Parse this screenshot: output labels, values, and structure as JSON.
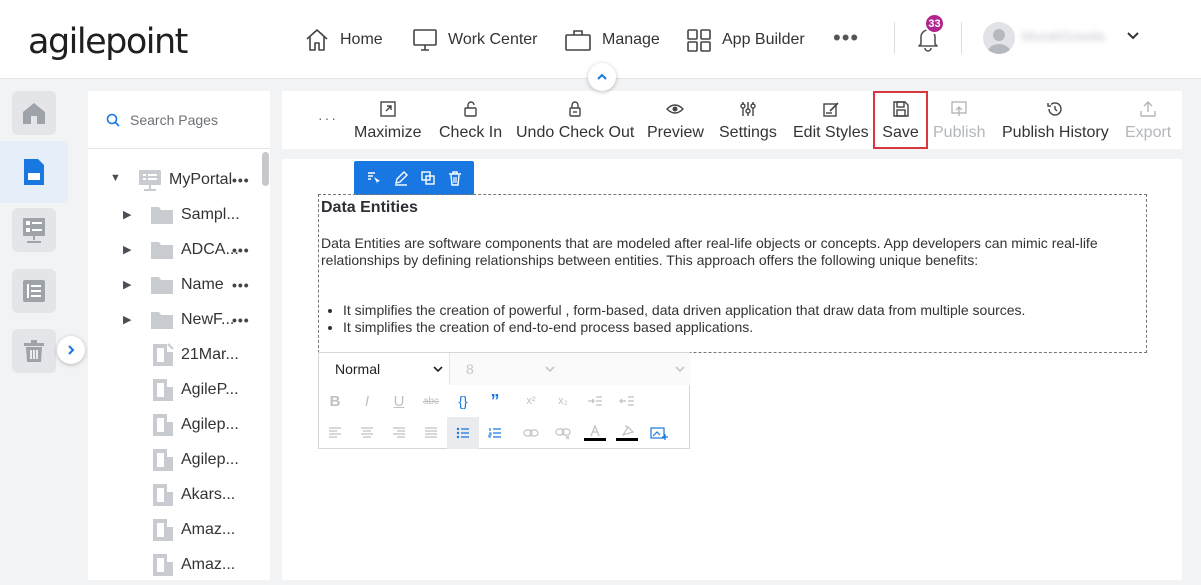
{
  "app": {
    "logo_text": "agilepoint"
  },
  "nav": {
    "items": [
      {
        "label": "Home",
        "icon": "home-icon"
      },
      {
        "label": "Work Center",
        "icon": "monitor-icon"
      },
      {
        "label": "Manage",
        "icon": "briefcase-icon"
      },
      {
        "label": "App Builder",
        "icon": "grid-icon"
      }
    ],
    "more": "•••",
    "notifications": {
      "count": "33",
      "icon": "bell-icon"
    },
    "user": {
      "name": "MuraliGowda",
      "icon": "avatar-icon"
    }
  },
  "rail": {
    "items": [
      "home-icon",
      "page-icon",
      "form-list-icon",
      "list-icon",
      "trash-icon"
    ],
    "active": "page-icon"
  },
  "pages_panel": {
    "search_placeholder": "Search Pages",
    "root": {
      "label": "MyPortal"
    },
    "items": [
      {
        "label": "Sampl...",
        "type": "folder",
        "more": false
      },
      {
        "label": "ADCA...",
        "type": "folder",
        "more": true
      },
      {
        "label": "Name",
        "type": "folder",
        "more": true
      },
      {
        "label": "NewF...",
        "type": "folder",
        "more": true
      },
      {
        "label": "21Mar...",
        "type": "page"
      },
      {
        "label": "AgileP...",
        "type": "page"
      },
      {
        "label": "Agilep...",
        "type": "page"
      },
      {
        "label": "Agilep...",
        "type": "page"
      },
      {
        "label": "Akars...",
        "type": "page"
      },
      {
        "label": "Amaz...",
        "type": "page"
      },
      {
        "label": "Amaz...",
        "type": "page"
      }
    ],
    "root_more": "•••"
  },
  "toolbar": {
    "overflow": "···",
    "tools": [
      {
        "label": "Maximize",
        "icon": "maximize-icon",
        "enabled": true
      },
      {
        "label": "Check In",
        "icon": "unlock-icon",
        "enabled": true
      },
      {
        "label": "Undo Check Out",
        "icon": "undo-lock-icon",
        "enabled": true
      },
      {
        "label": "Preview",
        "icon": "eye-icon",
        "enabled": true
      },
      {
        "label": "Settings",
        "icon": "sliders-icon",
        "enabled": true
      },
      {
        "label": "Edit Styles",
        "icon": "edit-styles-icon",
        "enabled": true
      },
      {
        "label": "Save",
        "icon": "save-icon",
        "enabled": true,
        "highlighted": true
      },
      {
        "label": "Publish",
        "icon": "publish-icon",
        "enabled": false
      },
      {
        "label": "Publish History",
        "icon": "history-icon",
        "enabled": true
      },
      {
        "label": "Export",
        "icon": "export-icon",
        "enabled": false
      }
    ]
  },
  "widget_tools": [
    "select-icon",
    "pencil-icon",
    "copy-icon",
    "delete-icon"
  ],
  "content": {
    "title": "Data Entities",
    "paragraph": "Data Entities are software components that are modeled after real-life objects or concepts. App developers can mimic real-life relationships by defining relationships between entities. This approach offers the following unique benefits:",
    "bullets": [
      "It simplifies the creation of powerful , form-based, data driven application that draw data from multiple sources.",
      "It simplifies the creation of end-to-end process based applications."
    ]
  },
  "editor": {
    "format": "Normal",
    "size": "8",
    "row1": [
      "B",
      "I",
      "U",
      "abc",
      "{}",
      "”",
      "x²",
      "x₂",
      "indent",
      "outdent"
    ],
    "row2": [
      "align-left",
      "align-center",
      "align-right",
      "justify",
      "bullet-list",
      "number-list",
      "link",
      "unlink",
      "font-color",
      "bg-color",
      "image"
    ]
  },
  "colors": {
    "accent": "#1877e0",
    "badge": "#b0258d",
    "highlight": "#d9363e"
  }
}
